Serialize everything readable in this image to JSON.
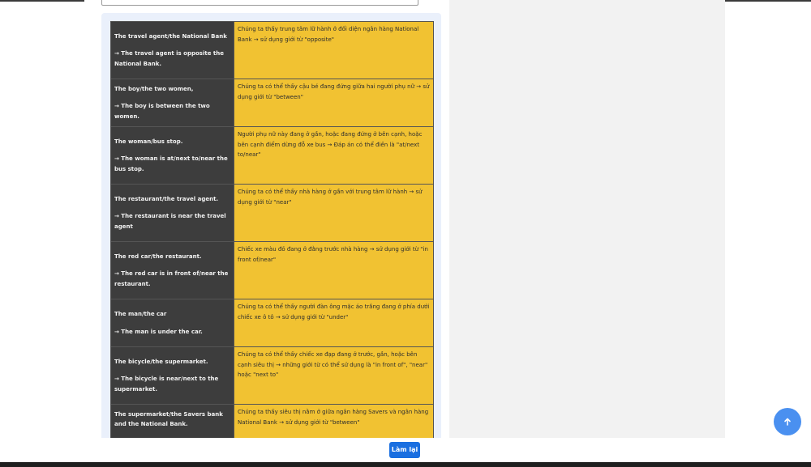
{
  "rows": [
    {
      "pair": "The travel agent/the National Bank",
      "sentence": "→ The travel agent is opposite the National Bank.",
      "explanation": "Chúng ta thấy trung tâm lữ hành ở đối diện ngân hàng National Bank → sử dụng giới từ \"opposite\""
    },
    {
      "pair": "The boy/the two women,",
      "sentence": "→ The boy is between the two women.",
      "explanation": "Chúng ta có thể thấy cậu bé đang đứng giữa hai người phụ nữ → sử dụng giới từ \"between\""
    },
    {
      "pair": "The woman/bus stop.",
      "sentence": "→ The woman is at/next to/near the bus stop.",
      "explanation": "Người phụ nữ này đang ở gần, hoặc đang đứng ở bên cạnh, hoặc bên cạnh điểm dừng đỗ xe bus → Đáp án có thể điền là \"at/next to/near\""
    },
    {
      "pair": "The restaurant/the travel agent.",
      "sentence": "→ The restaurant is near the travel agent",
      "explanation": "Chúng ta có thể thấy nhà hàng ở gần với trung tâm lữ hành → sử dụng giới từ \"near\""
    },
    {
      "pair": "The red car/the restaurant.",
      "sentence": "→ The red car is in front of/near the restaurant.",
      "explanation": "Chiếc xe màu đỏ đang ở đằng trước nhà hàng → sử dụng giới từ \"in front of/near\""
    },
    {
      "pair": "The man/the car",
      "sentence": "→ The man is under the car.",
      "explanation": "Chúng ta có thể thấy người đàn ông mặc áo trắng đang ở phía dưới chiếc xe ô tô → sử dụng giới từ \"under\""
    },
    {
      "pair": "The bicycle/the supermarket.",
      "sentence": "→ The bicycle is near/next to the supermarket.",
      "explanation": "Chúng ta có thể thấy chiếc xe đạp đang ở trước, gần, hoặc bên cạnh siêu thị → những giới từ có thể sử dụng là \"in front of\", \"near\" hoặc \"next to\""
    },
    {
      "pair": "The supermarket/the Savers bank and the National Bank.",
      "sentence": "",
      "explanation": "Chúng ta thấy siêu thị nằm ở giữa ngân hàng Savers và ngân hàng National Bank → sử dụng giới từ \"between\""
    }
  ],
  "retry_label": "Làm lại",
  "scroll_top_icon": "arrow-up-icon",
  "colors": {
    "question_cell": "#3d3d3d",
    "explanation_cell": "#f1c232",
    "primary_button": "#1a6fe0",
    "scroll_button": "#4a90f0"
  }
}
